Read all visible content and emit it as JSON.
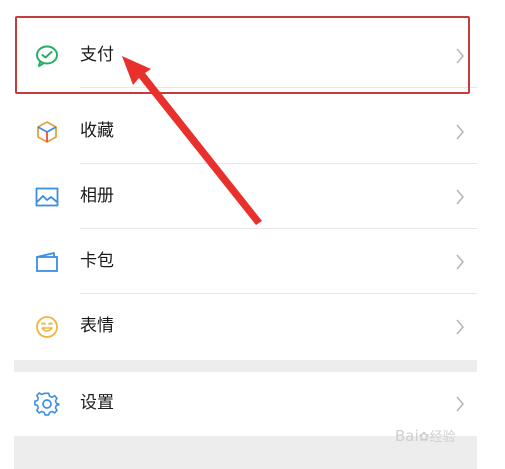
{
  "menu": {
    "items": [
      {
        "label": "支付",
        "icon": "wechat-pay-icon"
      },
      {
        "label": "收藏",
        "icon": "favorites-cube-icon"
      },
      {
        "label": "相册",
        "icon": "album-image-icon"
      },
      {
        "label": "卡包",
        "icon": "card-wallet-icon"
      },
      {
        "label": "表情",
        "icon": "sticker-smiley-icon"
      }
    ],
    "settings": {
      "label": "设置",
      "icon": "settings-gear-icon"
    }
  },
  "watermark": {
    "brand": "Bai",
    "brand2": "经验"
  },
  "colors": {
    "highlight": "#c43c3c",
    "arrow": "#e8312c",
    "pay_green": "#2aae67"
  }
}
